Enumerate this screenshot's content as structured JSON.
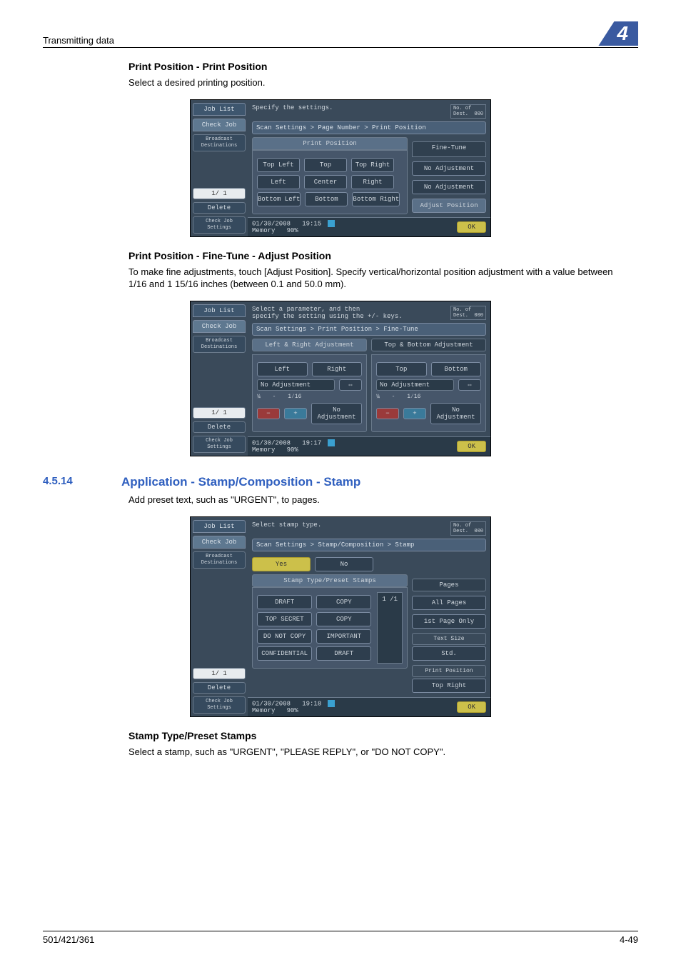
{
  "header": {
    "left": "Transmitting data",
    "chapter": "4"
  },
  "footer": {
    "left": "501/421/361",
    "right": "4-49"
  },
  "s1": {
    "title": "Print Position - Print Position",
    "para": "Select a desired printing position."
  },
  "s2": {
    "title": "Print Position - Fine-Tune - Adjust Position",
    "para": "To make fine adjustments, touch [Adjust Position]. Specify vertical/horizontal position adjustment with a value between 1/16 and 1 15/16 inches (between 0.1 and 50.0 mm)."
  },
  "s3": {
    "num": "4.5.14",
    "title": "Application - Stamp/Composition - Stamp",
    "para": "Add preset text, such as \"URGENT\", to pages."
  },
  "s4": {
    "title": "Stamp Type/Preset Stamps",
    "para": "Select a stamp, such as \"URGENT\", \"PLEASE REPLY\", or \"DO NOT COPY\"."
  },
  "common_left": {
    "job_list": "Job List",
    "check_job": "Check Job",
    "broadcast": "Broadcast\nDestinations",
    "page": "1/  1",
    "delete": "Delete",
    "check_settings": "Check Job\nSettings"
  },
  "dest": {
    "label": "No. of\nDest.",
    "count": "000"
  },
  "panel1": {
    "instr": "Specify the settings.",
    "crumb": "Scan Settings > Page Number > Print Position",
    "tabs": {
      "a": "Print Position",
      "b": "Fine-Tune"
    },
    "grid": {
      "r1": [
        "Top Left",
        "Top",
        "Top Right"
      ],
      "r2": [
        "Left",
        "Center",
        "Right"
      ],
      "r3": [
        "Bottom Left",
        "Bottom",
        "Bottom Right"
      ]
    },
    "side": [
      "No Adjustment",
      "No Adjustment",
      "Adjust Position"
    ],
    "status": {
      "date": "01/30/2008",
      "time": "19:15",
      "mem": "Memory",
      "mempct": "90%",
      "ok": "OK"
    }
  },
  "panel2": {
    "instr": "Select a parameter, and then\nspecify the setting using the +/- keys.",
    "crumb": "Scan Settings > Print Position > Fine-Tune",
    "tabs": {
      "a": "Left & Right Adjustment",
      "b": "Top & Bottom Adjustment"
    },
    "lr": {
      "left": "Left",
      "right": "Right",
      "noadj": "No Adjustment",
      "arrow": "⇔",
      "frac": "¼",
      "dash": "-",
      "val": "1⁄16",
      "minus": "−",
      "plus": "+",
      "noadj2": "No Adjustment"
    },
    "tb": {
      "top": "Top",
      "bottom": "Bottom",
      "noadj": "No Adjustment",
      "arrow": "⇔",
      "frac": "¼",
      "dash": "-",
      "val": "1⁄16",
      "minus": "−",
      "plus": "+",
      "noadj2": "No Adjustment"
    },
    "status": {
      "date": "01/30/2008",
      "time": "19:17",
      "mem": "Memory",
      "mempct": "90%",
      "ok": "OK"
    }
  },
  "panel3": {
    "instr": "Select stamp type.",
    "crumb": "Scan Settings > Stamp/Composition > Stamp",
    "yes": "Yes",
    "no": "No",
    "list_header": "Stamp Type/Preset Stamps",
    "stamps": [
      [
        "DRAFT",
        "COPY"
      ],
      [
        "TOP SECRET",
        "COPY"
      ],
      [
        "DO NOT COPY",
        "IMPORTANT"
      ],
      [
        "CONFIDENTIAL",
        "DRAFT"
      ]
    ],
    "pgcount": "1  /1",
    "side": {
      "pages_h": "Pages",
      "pages_opts": [
        "All Pages",
        "1st Page Only"
      ],
      "textsize_h": "Text Size",
      "textsize_v": "Std.",
      "printpos_h": "Print Position",
      "printpos_v": "Top Right"
    },
    "status": {
      "date": "01/30/2008",
      "time": "19:18",
      "mem": "Memory",
      "mempct": "90%",
      "ok": "OK"
    }
  }
}
